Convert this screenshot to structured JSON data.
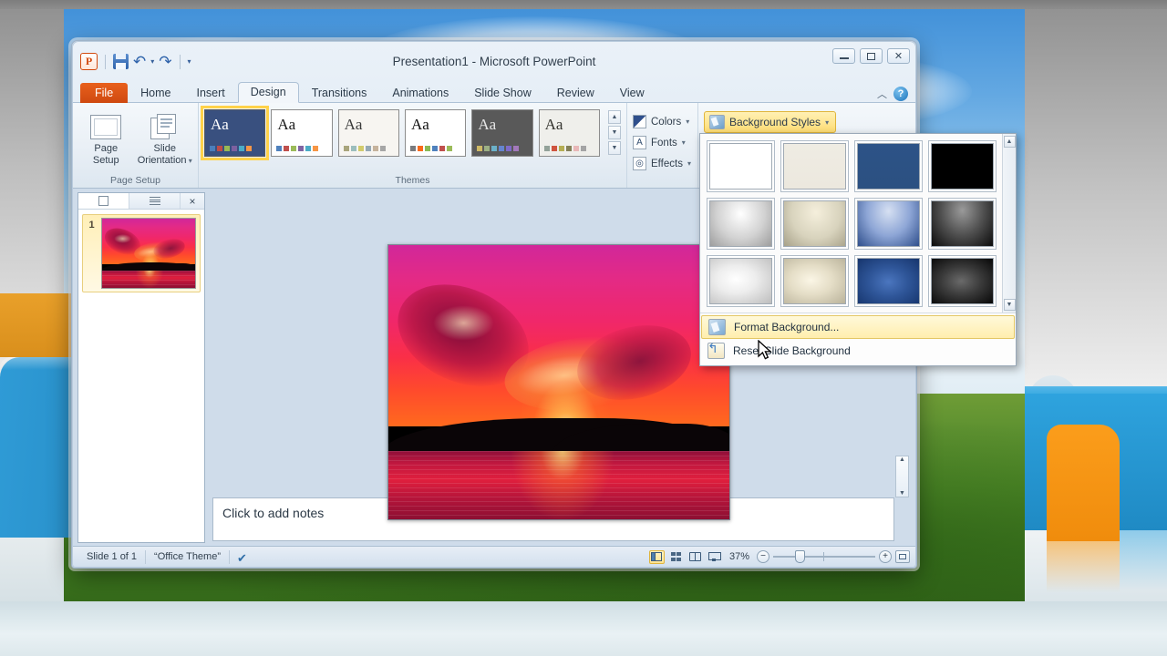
{
  "desktop": {
    "wallpaper_name": "bliss-wallpaper"
  },
  "window": {
    "title": "Presentation1  -  Microsoft PowerPoint",
    "app_logo": "P",
    "quick_access": [
      {
        "name": "save-button",
        "label": "Save"
      },
      {
        "name": "undo-button",
        "label": "Undo"
      },
      {
        "name": "redo-button",
        "label": "Redo"
      },
      {
        "name": "customize-qat-button",
        "label": "Customize Quick Access Toolbar"
      }
    ],
    "controls": {
      "minimize": "Minimize",
      "restore": "Restore Down",
      "close": "Close"
    },
    "ribbon_collapse": "Minimize the Ribbon",
    "help": "?"
  },
  "tabs": [
    {
      "label": "File",
      "active": false,
      "kind": "file"
    },
    {
      "label": "Home",
      "active": false
    },
    {
      "label": "Insert",
      "active": false
    },
    {
      "label": "Design",
      "active": true
    },
    {
      "label": "Transitions",
      "active": false
    },
    {
      "label": "Animations",
      "active": false
    },
    {
      "label": "Slide Show",
      "active": false
    },
    {
      "label": "Review",
      "active": false
    },
    {
      "label": "View",
      "active": false
    }
  ],
  "ribbon": {
    "page_setup": {
      "group_label": "Page Setup",
      "buttons": [
        {
          "label": "Page\nSetup",
          "line1": "Page",
          "line2": "Setup"
        },
        {
          "label": "Slide\nOrientation",
          "line1": "Slide",
          "line2": "Orientation"
        }
      ]
    },
    "themes": {
      "group_label": "Themes",
      "items": [
        {
          "name": "theme-office-dark",
          "selected": true,
          "aa": "Aa",
          "bg": "#39507f",
          "text_color": "#ffffff",
          "swatches": [
            "#4a7ebb",
            "#be4b48",
            "#98b954",
            "#7d60a0",
            "#4bacc6",
            "#f79646"
          ]
        },
        {
          "name": "theme-office",
          "selected": false,
          "aa": "Aa",
          "bg": "#ffffff",
          "text_color": "#1a1a1a",
          "swatches": [
            "#4f81bd",
            "#c0504d",
            "#9bbb59",
            "#8064a2",
            "#4bacc6",
            "#f79646"
          ]
        },
        {
          "name": "theme-adjacency",
          "selected": false,
          "aa": "Aa",
          "bg": "#f7f5f1",
          "text_color": "#3b3b3b",
          "swatches": [
            "#a9a57c",
            "#9cbebd",
            "#d2cb6c",
            "#95a9b5",
            "#c6b39c",
            "#a6a6a6"
          ]
        },
        {
          "name": "theme-angles",
          "selected": false,
          "aa": "Aa",
          "bg": "#ffffff",
          "text_color": "#111111",
          "swatches": [
            "#797b7e",
            "#f96a1b",
            "#8aba56",
            "#4f81bd",
            "#c0504d",
            "#9bbb59"
          ]
        },
        {
          "name": "theme-apex",
          "selected": false,
          "aa": "Aa",
          "bg": "#595959",
          "text_color": "#e6e6e6",
          "swatches": [
            "#ceb966",
            "#9cb084",
            "#6bb1c9",
            "#6585cf",
            "#7e6bc9",
            "#a379bb"
          ]
        },
        {
          "name": "theme-apothecary",
          "selected": false,
          "aa": "Aa",
          "bg": "#efefeb",
          "text_color": "#33332e",
          "swatches": [
            "#93a299",
            "#cf543f",
            "#b5ae53",
            "#848058",
            "#e8b7b7",
            "#a4a4a4"
          ]
        }
      ],
      "nav": {
        "up": "Previous row",
        "down": "Next row",
        "more": "More"
      }
    },
    "theme_parts": [
      {
        "name": "theme-colors",
        "label": "Colors",
        "icon": "palette-icon"
      },
      {
        "name": "theme-fonts",
        "label": "Fonts",
        "icon": "font-a-icon"
      },
      {
        "name": "theme-effects",
        "label": "Effects",
        "icon": "effects-circle-icon"
      }
    ],
    "background_styles_button": {
      "label": "Background Styles",
      "icon": "paint-bucket-icon",
      "active": true
    }
  },
  "background_dropdown": {
    "swatches": [
      {
        "name": "style-1",
        "css": "linear-gradient(180deg,#ffffff,#ffffff)"
      },
      {
        "name": "style-2",
        "css": "linear-gradient(180deg,#efece3,#ece8de)"
      },
      {
        "name": "style-3",
        "css": "linear-gradient(180deg,#2d5387,#2b5081)"
      },
      {
        "name": "style-4",
        "css": "linear-gradient(180deg,#000000,#000000)"
      },
      {
        "name": "style-5",
        "css": "radial-gradient(ellipse at 50% 28%,#ffffff 0%,#d2d2d2 55%,#9d9d9d 100%)"
      },
      {
        "name": "style-6",
        "css": "radial-gradient(ellipse at 52% 25%,#f5efdc 0%,#d8d3bd 55%,#a7a189 100%)"
      },
      {
        "name": "style-7",
        "css": "radial-gradient(ellipse at 50% 22%,#d6e0f2 0%,#8ea6d6 50%,#2f4f8c 100%)"
      },
      {
        "name": "style-8",
        "css": "radial-gradient(ellipse at 50% 20%,#9a9a9a 0%,#4f4f4f 50%,#0b0b0b 100%)"
      },
      {
        "name": "style-9",
        "css": "radial-gradient(ellipse at 42% 46%,#ffffff 0%,#ededed 40%,#bdbdbd 100%)"
      },
      {
        "name": "style-10",
        "css": "radial-gradient(ellipse at 44% 48%,#fbf6e6 0%,#e4ddc6 45%,#b9b29a 100%)"
      },
      {
        "name": "style-11",
        "css": "radial-gradient(ellipse at 50% 52%,#4b76bf 0%,#2f5699 45%,#16356d 100%)"
      },
      {
        "name": "style-12",
        "css": "radial-gradient(ellipse at 48% 50%,#6a6a6a 0%,#3a3a3a 45%,#070707 100%)"
      }
    ],
    "scrollbar": {
      "up": "▲",
      "down": "▼"
    },
    "menu": [
      {
        "name": "format-background-item",
        "label": "Format Background...",
        "highlighted": true,
        "icon": "paint-bucket-icon"
      },
      {
        "name": "reset-slide-background-item",
        "label": "Reset Slide Background",
        "highlighted": false,
        "icon": "reset-arrow-icon"
      }
    ]
  },
  "slide_pane": {
    "tabs": [
      {
        "name": "slides-tab",
        "label": "Slides",
        "selected": true
      },
      {
        "name": "outline-tab",
        "label": "Outline",
        "selected": false
      }
    ],
    "close_label": "×",
    "slides": [
      {
        "number": "1",
        "name": "slide-thumbnail-1"
      }
    ]
  },
  "editor": {
    "slide_image_alt": "pink sunset over water",
    "notes_placeholder": "Click to add notes"
  },
  "status_bar": {
    "slide_count": "Slide 1 of 1",
    "theme_name": "“Office Theme”",
    "spellcheck_icon": "spellcheck-icon",
    "views": [
      {
        "name": "view-normal",
        "label": "Normal",
        "selected": true
      },
      {
        "name": "view-slide-sorter",
        "label": "Slide Sorter",
        "selected": false
      },
      {
        "name": "view-reading",
        "label": "Reading View",
        "selected": false
      },
      {
        "name": "view-slideshow",
        "label": "Slide Show",
        "selected": false
      }
    ],
    "zoom_level": "37%",
    "zoom_out": "−",
    "zoom_in": "+",
    "fit_label": "Fit slide to current window"
  },
  "colors": {
    "accent_orange": "#d2490d",
    "highlight_yellow": "#ffdd74",
    "ribbon_bg": "#eaf0f6",
    "selection_gold": "#ffd24a"
  }
}
